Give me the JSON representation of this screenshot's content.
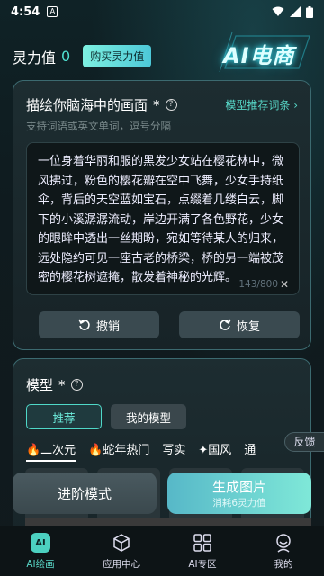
{
  "status": {
    "time": "4:54",
    "a_label": "A"
  },
  "balance": {
    "label": "灵力值",
    "value": "0",
    "buy_label": "购买灵力值"
  },
  "logo": {
    "text": "AI电商"
  },
  "prompt": {
    "title": "描绘你脑海中的画面",
    "star": "*",
    "help": "?",
    "recommend_link": "模型推荐词条 ›",
    "hint": "支持词语或英文单词，逗号分隔",
    "text": "一位身着华丽和服的黑发少女站在樱花林中，微风拂过，粉色的樱花瓣在空中飞舞，少女手持纸伞，背后的天空蓝如宝石，点缀着几缕白云，脚下的小溪潺潺流动，岸边开满了各色野花，少女的眼眸中透出一丝期盼，宛如等待某人的归来，远处隐约可见一座古老的桥梁，桥的另一端被茂密的樱花树遮掩，散发着神秘的光辉。",
    "counter": "143/800",
    "clear": "✕",
    "undo_label": "撤销",
    "redo_label": "恢复"
  },
  "model": {
    "title": "模型",
    "star": "*",
    "help": "?",
    "tab_recommend": "推荐",
    "tab_mine": "我的模型",
    "categories": [
      "🔥二次元",
      "🔥蛇年热门",
      "写实",
      "✦国风",
      "通"
    ]
  },
  "feedback": "反馈",
  "actions": {
    "advanced": "进阶模式",
    "generate": "生成图片",
    "generate_sub": "消耗6灵力值"
  },
  "nav": [
    {
      "label": "AI绘画",
      "icon": "ai-badge"
    },
    {
      "label": "应用中心",
      "icon": "cube-icon"
    },
    {
      "label": "AI专区",
      "icon": "grid-icon"
    },
    {
      "label": "我的",
      "icon": "user-icon"
    }
  ],
  "colors": {
    "accent": "#4fe0d0",
    "background": "#101c20"
  }
}
